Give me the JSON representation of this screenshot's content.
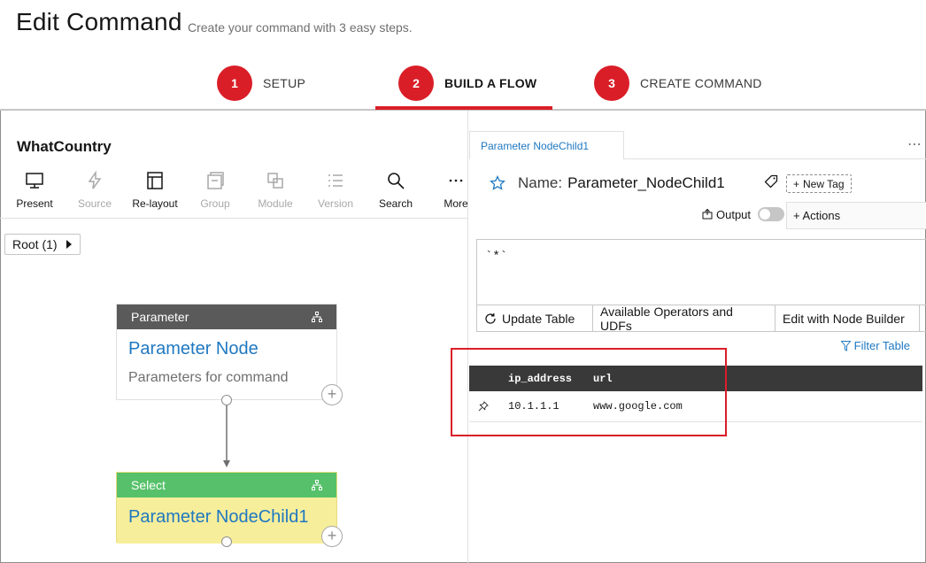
{
  "header": {
    "title": "Edit Command",
    "subtitle": "Create your command with 3 easy steps.",
    "steps": [
      {
        "num": "1",
        "label": "SETUP"
      },
      {
        "num": "2",
        "label": "BUILD A FLOW"
      },
      {
        "num": "3",
        "label": "CREATE COMMAND"
      }
    ],
    "active_step": 2
  },
  "flow": {
    "name": "WhatCountry",
    "toolbar": [
      {
        "label": "Present",
        "icon": "monitor-icon",
        "enabled": true
      },
      {
        "label": "Source",
        "icon": "lightning-icon",
        "enabled": false
      },
      {
        "label": "Re-layout",
        "icon": "layout-icon",
        "enabled": true
      },
      {
        "label": "Group",
        "icon": "group-icon",
        "enabled": false
      },
      {
        "label": "Module",
        "icon": "module-icon",
        "enabled": false
      },
      {
        "label": "Version",
        "icon": "list-icon",
        "enabled": false
      },
      {
        "label": "Search",
        "icon": "search-icon",
        "enabled": true
      },
      {
        "label": "More",
        "icon": "overflow-icon",
        "enabled": true
      }
    ],
    "breadcrumb": "Root (1)",
    "nodes": [
      {
        "type": "Parameter",
        "title": "Parameter Node",
        "description": "Parameters for command",
        "header_color": "#5a5a5a",
        "body_color": "#ffffff"
      },
      {
        "type": "Select",
        "title": "Parameter NodeChild1",
        "description": "",
        "header_color": "#56c16a",
        "body_color": "#f7ee9b"
      }
    ]
  },
  "detail": {
    "tab_label": "Parameter NodeChild1",
    "name_label": "Name:",
    "name_value": "Parameter_NodeChild1",
    "new_tag_label": "New Tag",
    "output_label": "Output",
    "actions_label": "+ Actions",
    "editor_text": "`*`",
    "buttons": [
      "Update Table",
      "Available Operators and UDFs",
      "Edit with Node Builder"
    ],
    "filter_label": "Filter Table",
    "table": {
      "columns": [
        "ip_address",
        "url"
      ],
      "rows": [
        [
          "10.1.1.1",
          "www.google.com"
        ]
      ]
    }
  },
  "colors": {
    "accent": "#da1e28",
    "link": "#1f78c1"
  }
}
